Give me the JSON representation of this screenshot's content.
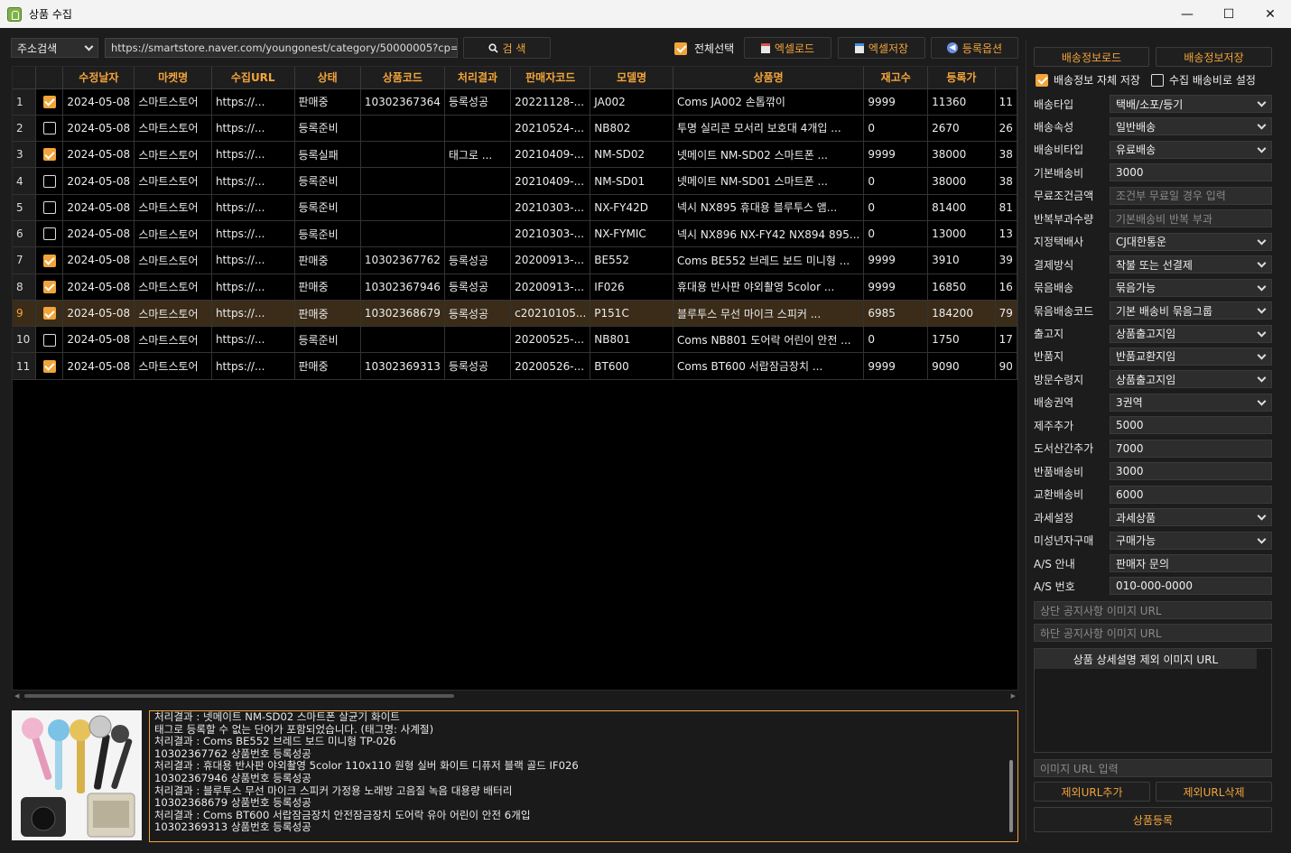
{
  "window": {
    "title": "상품 수집",
    "minimize": "—",
    "maximize": "☐",
    "close": "✕"
  },
  "toolbar": {
    "search_type": "주소검색",
    "url_value": "https://smartstore.naver.com/youngonest/category/50000005?cp=1",
    "search_button": "검  색",
    "select_all_label": "전체선택",
    "excel_load": "엑셀로드",
    "excel_save": "엑셀저장",
    "register_options": "등록옵션"
  },
  "grid": {
    "columns": [
      "",
      "",
      "수정날자",
      "마켓명",
      "수집URL",
      "상태",
      "상품코드",
      "처리결과",
      "판매자코드",
      "모델명",
      "상품명",
      "재고수",
      "등록가",
      ""
    ],
    "rows": [
      {
        "num": "1",
        "checked": true,
        "date": "2024-05-08",
        "market": "스마트스토어",
        "url": "https://...",
        "status": "판매중",
        "code": "10302367364",
        "result": "등록성공",
        "seller": "20221128-...",
        "model": "JA002",
        "name": "Coms JA002 손톱깎이",
        "stock": "9999",
        "price": "11360",
        "extra": "11"
      },
      {
        "num": "2",
        "checked": false,
        "date": "2024-05-08",
        "market": "스마트스토어",
        "url": "https://...",
        "status": "등록준비",
        "code": "",
        "result": "",
        "seller": "20210524-...",
        "model": "NB802",
        "name": "투명 실리콘 모서리 보호대 4개입 ...",
        "stock": "0",
        "price": "2670",
        "extra": "26"
      },
      {
        "num": "3",
        "checked": true,
        "date": "2024-05-08",
        "market": "스마트스토어",
        "url": "https://...",
        "status": "등록실패",
        "code": "",
        "result": "태그로 ...",
        "seller": "20210409-...",
        "model": "NM-SD02",
        "name": "넷메이트 NM-SD02 스마트폰 ...",
        "stock": "9999",
        "price": "38000",
        "extra": "38"
      },
      {
        "num": "4",
        "checked": false,
        "date": "2024-05-08",
        "market": "스마트스토어",
        "url": "https://...",
        "status": "등록준비",
        "code": "",
        "result": "",
        "seller": "20210409-...",
        "model": "NM-SD01",
        "name": "넷메이트 NM-SD01 스마트폰 ...",
        "stock": "0",
        "price": "38000",
        "extra": "38"
      },
      {
        "num": "5",
        "checked": false,
        "date": "2024-05-08",
        "market": "스마트스토어",
        "url": "https://...",
        "status": "등록준비",
        "code": "",
        "result": "",
        "seller": "20210303-...",
        "model": "NX-FY42D",
        "name": "넥시 NX895 휴대용 블루투스 앰...",
        "stock": "0",
        "price": "81400",
        "extra": "81"
      },
      {
        "num": "6",
        "checked": false,
        "date": "2024-05-08",
        "market": "스마트스토어",
        "url": "https://...",
        "status": "등록준비",
        "code": "",
        "result": "",
        "seller": "20210303-...",
        "model": "NX-FYMIC",
        "name": "넥시 NX896 NX-FY42 NX894 895...",
        "stock": "0",
        "price": "13000",
        "extra": "13"
      },
      {
        "num": "7",
        "checked": true,
        "date": "2024-05-08",
        "market": "스마트스토어",
        "url": "https://...",
        "status": "판매중",
        "code": "10302367762",
        "result": "등록성공",
        "seller": "20200913-...",
        "model": "BE552",
        "name": "Coms BE552 브레드 보드 미니형 ...",
        "stock": "9999",
        "price": "3910",
        "extra": "39"
      },
      {
        "num": "8",
        "checked": true,
        "date": "2024-05-08",
        "market": "스마트스토어",
        "url": "https://...",
        "status": "판매중",
        "code": "10302367946",
        "result": "등록성공",
        "seller": "20200913-...",
        "model": "IF026",
        "name": "휴대용 반사판 야외촬영 5color ...",
        "stock": "9999",
        "price": "16850",
        "extra": "16"
      },
      {
        "num": "9",
        "checked": true,
        "selected": true,
        "date": "2024-05-08",
        "market": "스마트스토어",
        "url": "https://...",
        "status": "판매중",
        "code": "10302368679",
        "result": "등록성공",
        "seller": "c20210105...",
        "model": "P151C",
        "name": "블루투스 무선 마이크 스피커 ...",
        "stock": "6985",
        "price": "184200",
        "extra": "79"
      },
      {
        "num": "10",
        "checked": false,
        "date": "2024-05-08",
        "market": "스마트스토어",
        "url": "https://...",
        "status": "등록준비",
        "code": "",
        "result": "",
        "seller": "20200525-...",
        "model": "NB801",
        "name": "Coms NB801 도어락 어린이 안전 ...",
        "stock": "0",
        "price": "1750",
        "extra": "17"
      },
      {
        "num": "11",
        "checked": true,
        "date": "2024-05-08",
        "market": "스마트스토어",
        "url": "https://...",
        "status": "판매중",
        "code": "10302369313",
        "result": "등록성공",
        "seller": "20200526-...",
        "model": "BT600",
        "name": "Coms BT600 서랍잠금장치 ...",
        "stock": "9999",
        "price": "9090",
        "extra": "90"
      }
    ]
  },
  "log": {
    "lines": [
      "처리결과 : 넷메이트 NM-SD02 스마트폰 살균기 화이트",
      "태그로 등록할 수 없는 단어가 포함되었습니다. (태그명: 사계절)",
      "처리결과 : Coms BE552 브레드 보드 미니형  TP-026",
      "10302367762 상품번호 등록성공",
      "처리결과 : 휴대용 반사판 야외촬영 5color 110x110 원형 실버 화이트 디퓨저 블랙 골드 IF026",
      "10302367946 상품번호 등록성공",
      "처리결과 : 블루투스 무선 마이크 스피커 가정용 노래방 고음질 녹음 대용량 배터리",
      "10302368679 상품번호 등록성공",
      "처리결과 : Coms BT600 서랍잠금장치 안전잠금장치 도어락 유아 어린이 안전 6개입",
      "10302369313 상품번호 등록성공"
    ]
  },
  "side": {
    "shipping_load": "배송정보로드",
    "shipping_save": "배송정보저장",
    "self_save_label": "배송정보 자체 저장",
    "collect_shipping_label": "수집 배송비로 설정",
    "fields": [
      {
        "label": "배송타입",
        "value": "택배/소포/등기",
        "dropdown": true
      },
      {
        "label": "배송속성",
        "value": "일반배송",
        "dropdown": true
      },
      {
        "label": "배송비타입",
        "value": "유료배송",
        "dropdown": true
      },
      {
        "label": "기본배송비",
        "value": "3000",
        "dropdown": false
      },
      {
        "label": "무료조건금액",
        "value": "조건부 무료일 경우 입력",
        "dropdown": false,
        "placeholder": true
      },
      {
        "label": "반복부과수량",
        "value": "기본배송비 반복 부과",
        "dropdown": false,
        "placeholder": true
      },
      {
        "label": "지정택배사",
        "value": "CJ대한통운",
        "dropdown": true
      },
      {
        "label": "결제방식",
        "value": "착불 또는 선결제",
        "dropdown": true
      },
      {
        "label": "묶음배송",
        "value": "묶음가능",
        "dropdown": true
      },
      {
        "label": "묶음배송코드",
        "value": "기본 배송비 묶음그룹",
        "dropdown": true
      },
      {
        "label": "출고지",
        "value": "상품출고지임",
        "dropdown": true
      },
      {
        "label": "반품지",
        "value": "반품교환지임",
        "dropdown": true
      },
      {
        "label": "방문수령지",
        "value": "상품출고지임",
        "dropdown": true
      },
      {
        "label": "배송권역",
        "value": "3권역",
        "dropdown": true
      },
      {
        "label": "제주추가",
        "value": "5000",
        "dropdown": false
      },
      {
        "label": "도서산간추가",
        "value": "7000",
        "dropdown": false
      },
      {
        "label": "반품배송비",
        "value": "3000",
        "dropdown": false
      },
      {
        "label": "교환배송비",
        "value": "6000",
        "dropdown": false
      },
      {
        "label": "과세설정",
        "value": "과세상품",
        "dropdown": true
      },
      {
        "label": "미성년자구매",
        "value": "구매가능",
        "dropdown": true
      },
      {
        "label": "A/S 안내",
        "value": "판매자 문의",
        "dropdown": false
      },
      {
        "label": "A/S 번호",
        "value": "010-000-0000",
        "dropdown": false
      }
    ],
    "top_notice_placeholder": "상단 공지사항 이미지 URL",
    "bottom_notice_placeholder": "하단 공지사항 이미지 URL",
    "exclude_list_header": "상품 상세설명 제외 이미지 URL",
    "image_url_placeholder": "이미지 URL 입력",
    "add_exclude": "제외URL추가",
    "delete_exclude": "제외URL삭제",
    "register_product": "상품등록"
  },
  "colors": {
    "accent": "#f2a43a",
    "background": "#1c1c1c",
    "grid_bg": "#000000",
    "selected_row": "#3a2c19"
  }
}
